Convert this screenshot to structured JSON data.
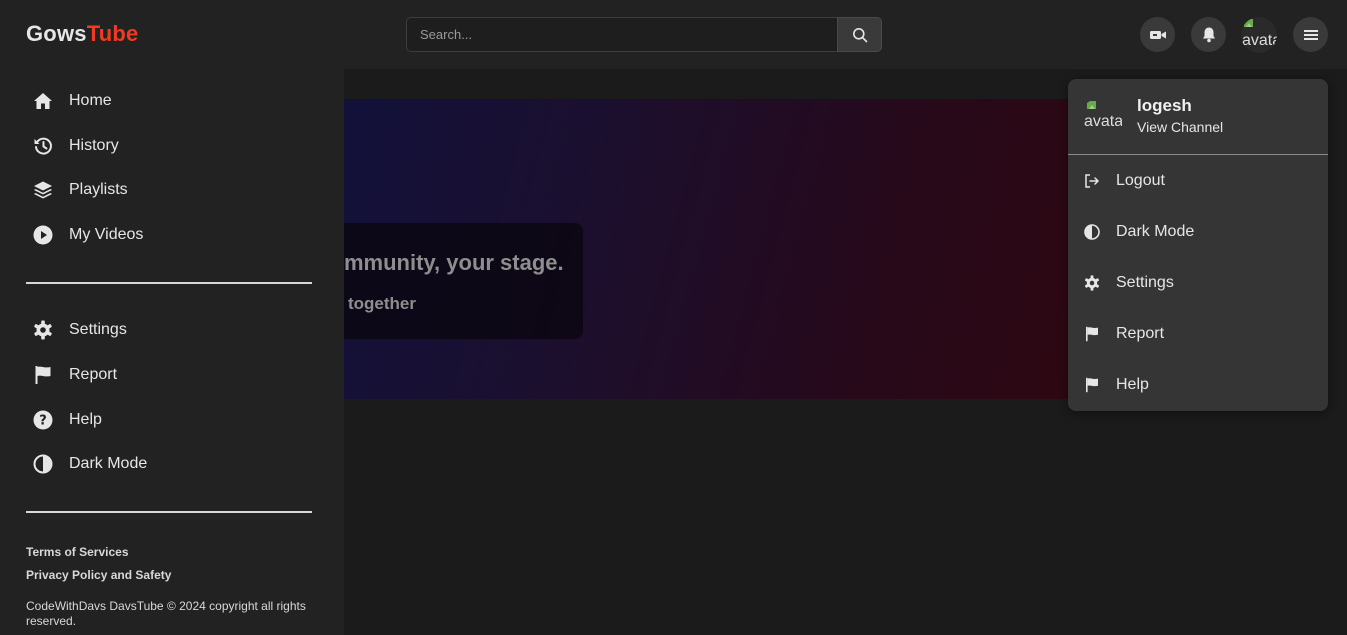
{
  "header": {
    "logo_part1": "Gows",
    "logo_part2": "Tube",
    "search_placeholder": "Search...",
    "icons": [
      "video-camera-icon",
      "bell-icon",
      "avatar",
      "menu-icon"
    ],
    "avatar_alt": "avatar"
  },
  "sidebar": {
    "main_items": [
      {
        "label": "Home",
        "icon": "home-icon"
      },
      {
        "label": "History",
        "icon": "history-icon"
      },
      {
        "label": "Playlists",
        "icon": "layers-icon"
      },
      {
        "label": "My Videos",
        "icon": "play-circle-icon"
      }
    ],
    "secondary_items": [
      {
        "label": "Settings",
        "icon": "gear-icon"
      },
      {
        "label": "Report",
        "icon": "flag-icon"
      },
      {
        "label": "Help",
        "icon": "question-circle-icon"
      },
      {
        "label": "Dark Mode",
        "icon": "half-circle-icon"
      }
    ],
    "footer_links": [
      "Terms of Services",
      "Privacy Policy and Safety"
    ],
    "copyright": "CodeWithDavs DavsTube © 2024 copyright all rights reserved."
  },
  "hero": {
    "title_visible": "mmunity, your stage.",
    "subtitle_visible": "together"
  },
  "user_menu": {
    "username": "logesh",
    "view_channel": "View Channel",
    "avatar_alt": "avatar",
    "items": [
      {
        "label": "Logout",
        "icon": "logout-icon"
      },
      {
        "label": "Dark Mode",
        "icon": "half-circle-icon"
      },
      {
        "label": "Settings",
        "icon": "gear-icon"
      },
      {
        "label": "Report",
        "icon": "flag-icon"
      },
      {
        "label": "Help",
        "icon": "flag-icon"
      }
    ]
  },
  "colors": {
    "brand_accent": "#ef3b24",
    "background": "#1b1b1b",
    "panel": "#222222",
    "dropdown": "#353535"
  }
}
